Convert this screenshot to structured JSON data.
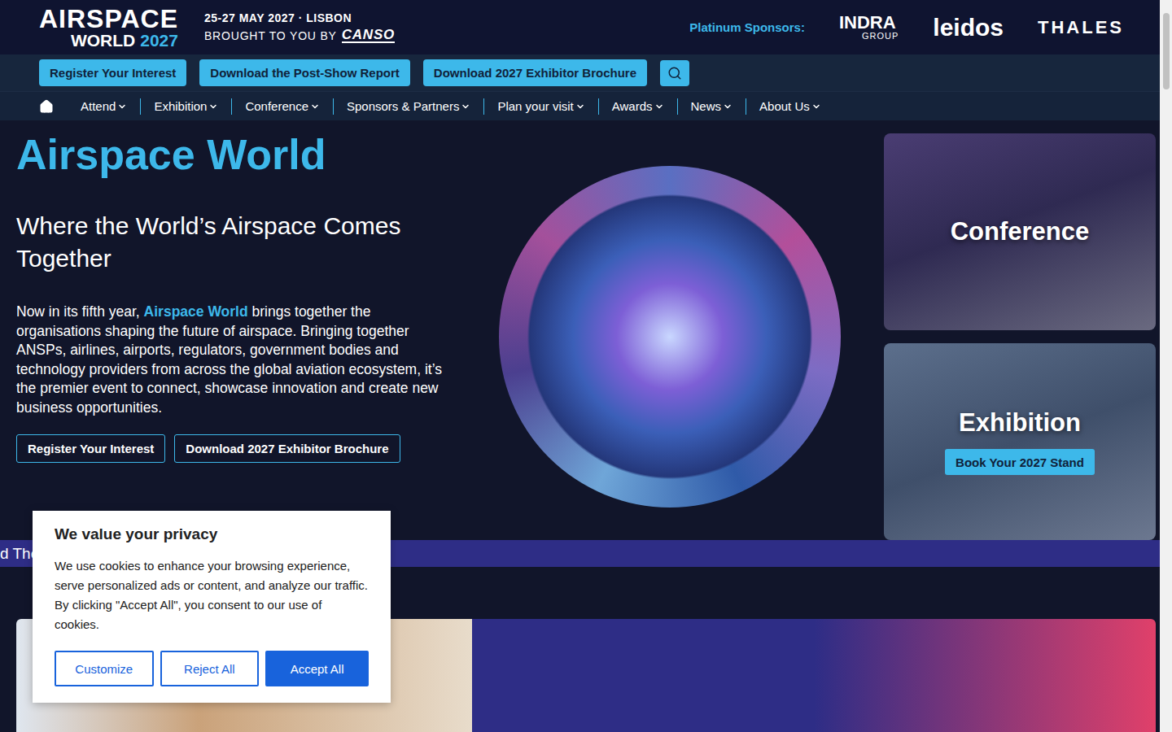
{
  "header": {
    "logo_top": "AIRSPACE",
    "logo_word": "WORLD",
    "logo_year": "2027",
    "dates": "25-27 MAY 2027 · LISBON",
    "brought_by": "BROUGHT TO YOU BY",
    "brand": "CANSO",
    "sponsors_label": "Platinum Sponsors:",
    "sponsors": [
      {
        "name": "INDRA",
        "sub": "GROUP"
      },
      {
        "name": "leidos",
        "sub": ""
      },
      {
        "name": "THALES",
        "sub": ""
      }
    ]
  },
  "cta_buttons": [
    "Register Your Interest",
    "Download the Post-Show Report",
    "Download 2027 Exhibitor Brochure"
  ],
  "nav": {
    "items": [
      "Attend",
      "Exhibition",
      "Conference",
      "Sponsors & Partners",
      "Plan your visit",
      "Awards",
      "News",
      "About Us"
    ]
  },
  "hero": {
    "title": "Airspace World",
    "subtitle": "Where the World’s Airspace Comes Together",
    "intro_before": "Now in its fifth year, ",
    "intro_highlight": "Airspace World",
    "intro_after": " brings together the organisations shaping the future of airspace. Bringing together ANSPs, airlines, airports, regulators, government bodies and technology providers from across the global aviation ecosystem, it’s the premier event to connect, showcase innovation and create new business opportunities.",
    "buttons": [
      "Register Your Interest",
      "Download 2027 Exhibitor Brochure"
    ]
  },
  "cards": [
    {
      "title": "Conference",
      "button": ""
    },
    {
      "title": "Exhibition",
      "button": "Book Your 2027 Stand"
    }
  ],
  "ticker": "d The",
  "cookie": {
    "title": "We value your privacy",
    "text": "We use cookies to enhance your browsing experience, serve personalized ads or content, and analyze our traffic. By clicking \"Accept All\", you consent to our use of cookies.",
    "buttons": [
      {
        "label": "Customize",
        "kind": "outline"
      },
      {
        "label": "Reject All",
        "kind": "outline"
      },
      {
        "label": "Accept All",
        "kind": "filled"
      }
    ]
  }
}
